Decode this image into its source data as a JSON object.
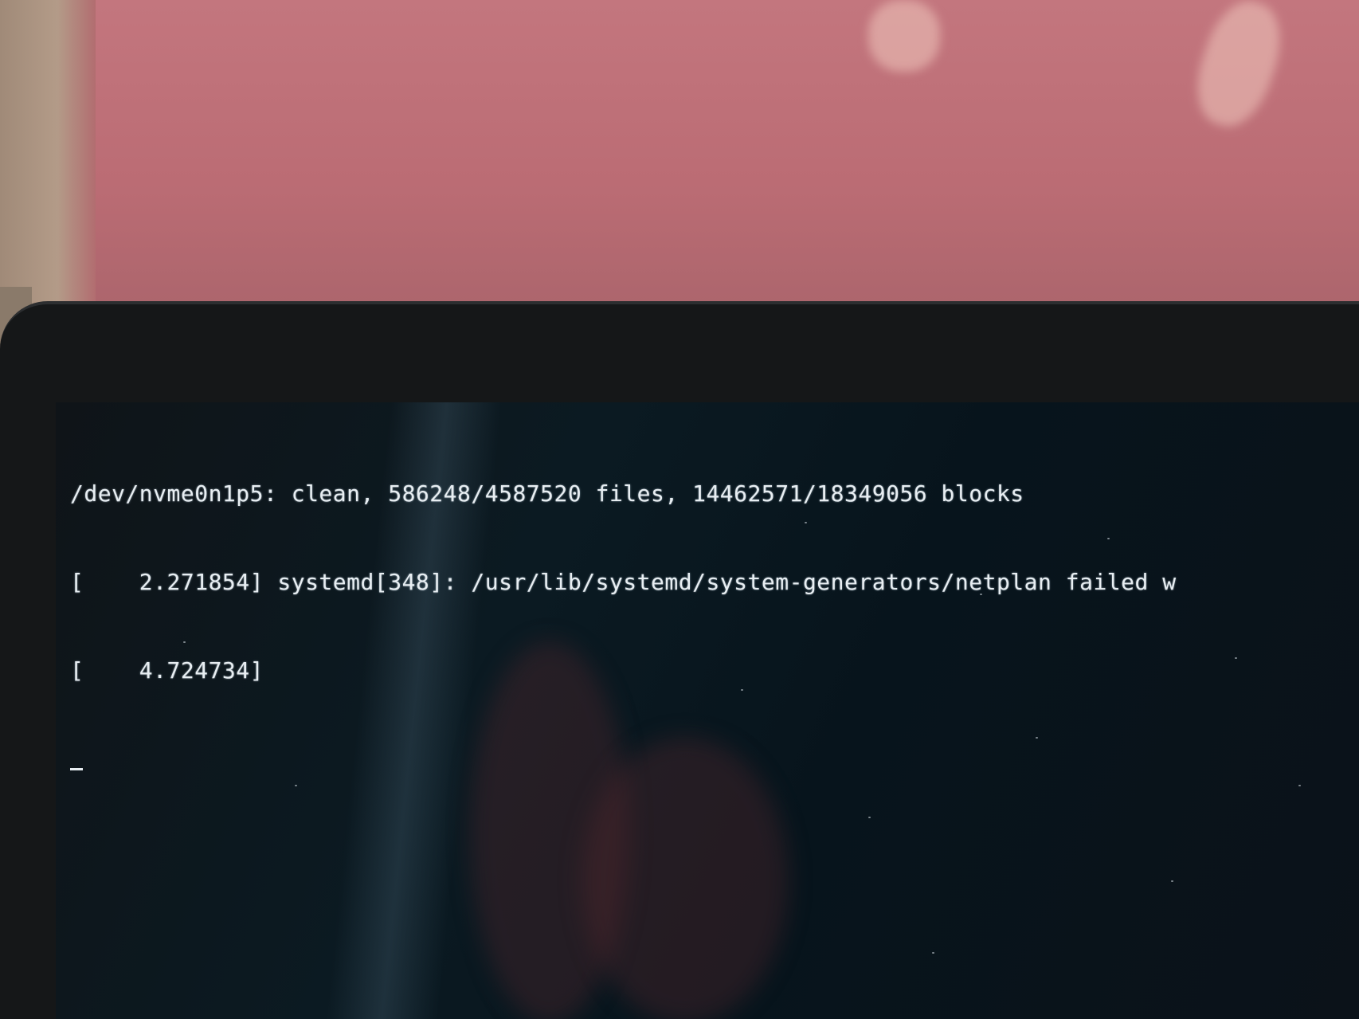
{
  "terminal": {
    "lines": [
      "/dev/nvme0n1p5: clean, 586248/4587520 files, 14462571/18349056 blocks",
      "[    2.271854] systemd[348]: /usr/lib/systemd/system-generators/netplan failed w",
      "[    4.724734]"
    ],
    "cursor": "_"
  },
  "colors": {
    "text": "#e8eef2",
    "screen": "#0b1a22",
    "bezel": "#151718",
    "background": "#bb6c74"
  }
}
